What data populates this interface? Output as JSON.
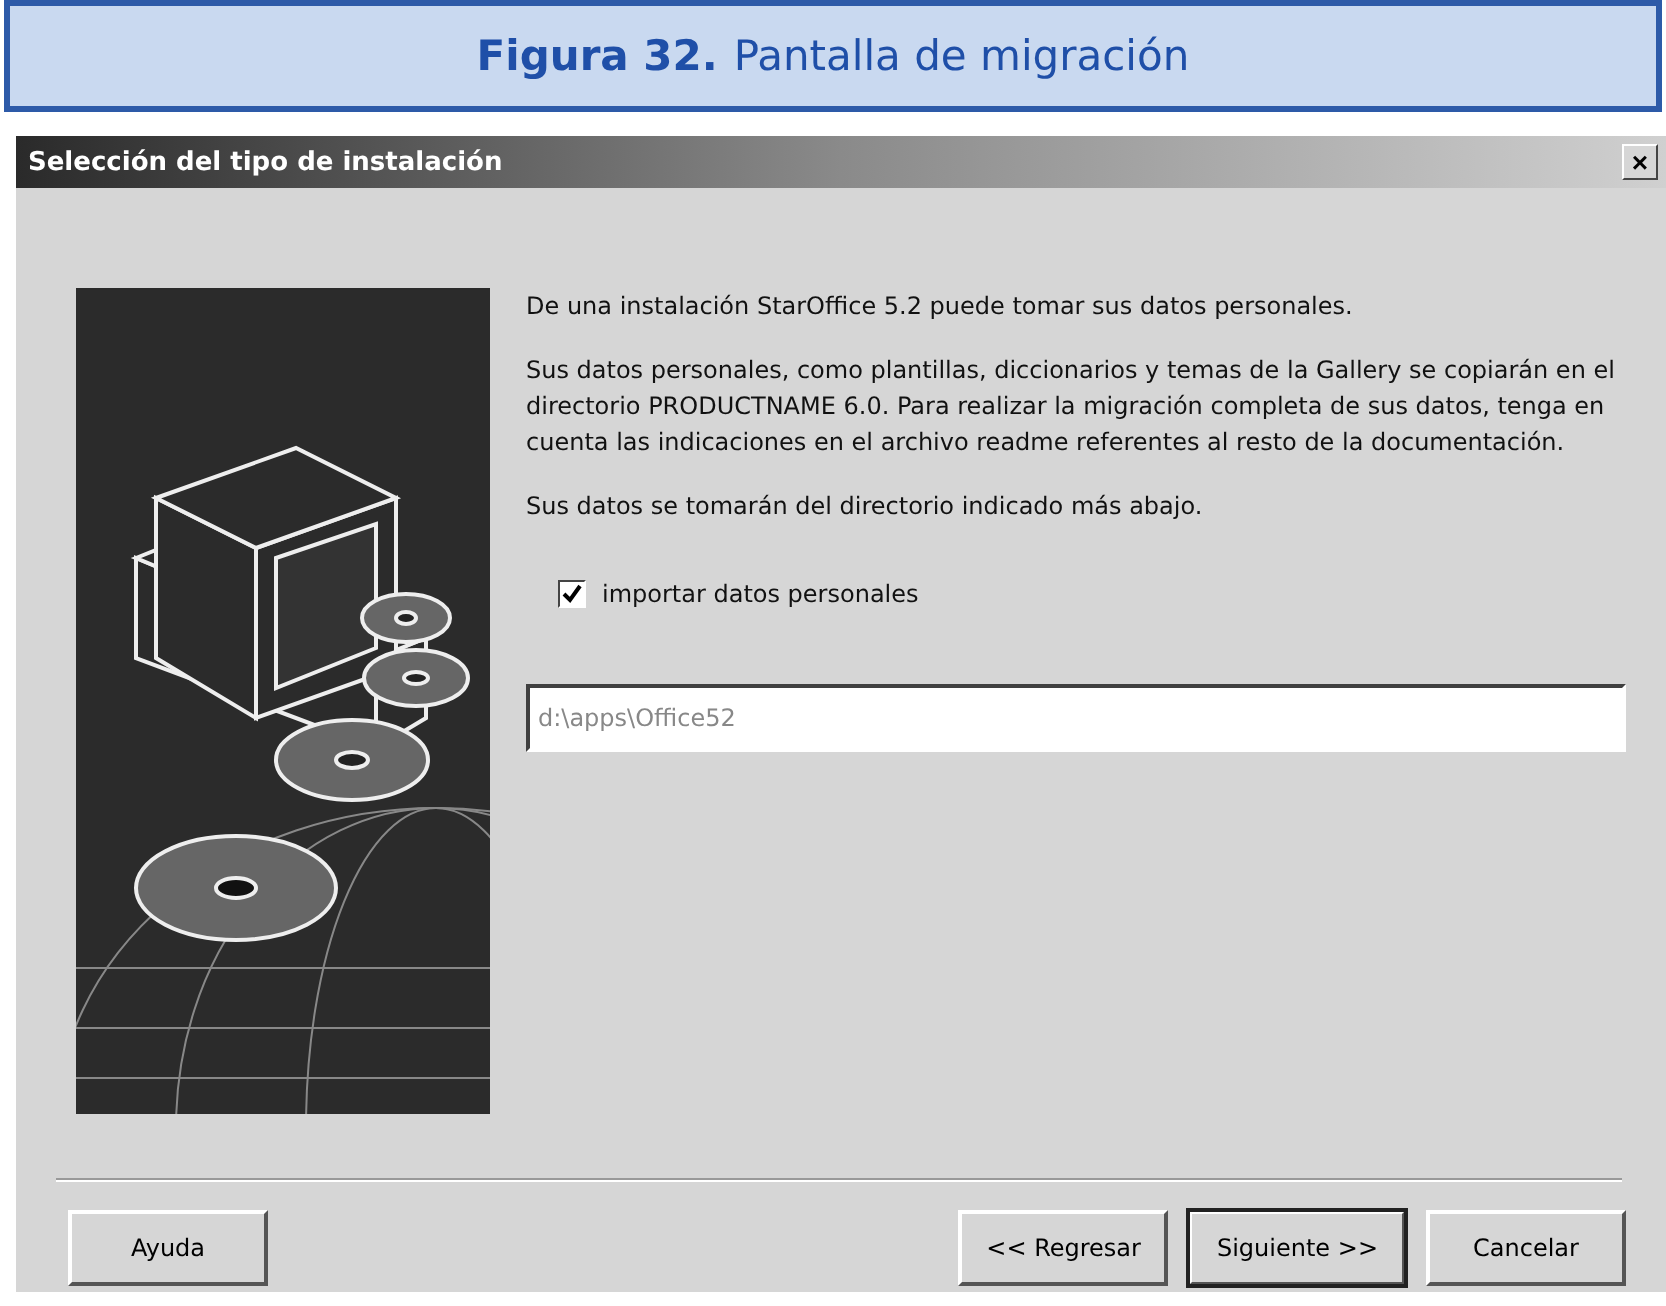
{
  "caption": {
    "label": "Figura 32.",
    "title": "Pantalla de migración"
  },
  "window": {
    "title": "Selección del tipo de instalación",
    "close": "×"
  },
  "paragraphs": [
    "De una instalación StarOffice 5.2 puede tomar sus datos personales.",
    "Sus datos personales, como plantillas, diccionarios y temas de la Gallery se copiarán en el directorio PRODUCTNAME 6.0. Para realizar la migración completa de sus datos, tenga en cuenta las indicaciones en el archivo readme referentes al resto de la documentación.",
    "Sus datos se tomarán del directorio indicado más abajo."
  ],
  "import_checkbox": {
    "label": "importar datos personales",
    "checked": true
  },
  "path_field": {
    "value": "d:\\apps\\Office52"
  },
  "buttons": [
    {
      "label": "Ayuda",
      "default": false
    },
    {
      "label": "<< Regresar",
      "default": false
    },
    {
      "label": "Siguiente >>",
      "default": true
    },
    {
      "label": "Cancelar",
      "default": false
    }
  ]
}
